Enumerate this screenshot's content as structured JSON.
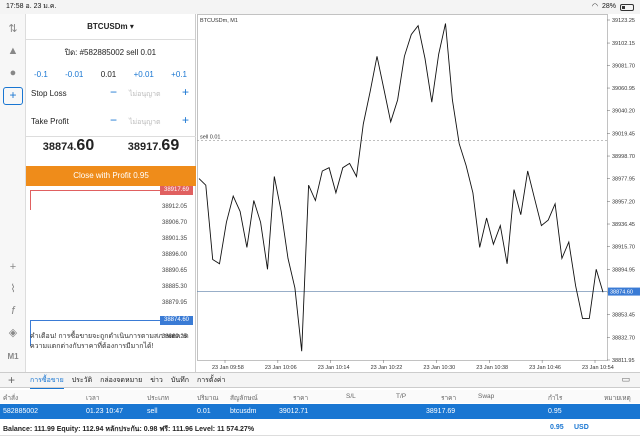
{
  "status": {
    "time": "17:58",
    "date": "อ. 23 ม.ค.",
    "wifi": "wifi",
    "battery": "28%"
  },
  "sidebar": {
    "icons": [
      "quotes-icon",
      "charts-icon",
      "chat-icon",
      "new-order-icon"
    ],
    "tools": [
      "crosshair-icon",
      "indicators-icon",
      "function-icon",
      "objects-icon"
    ],
    "timeframe": "M1"
  },
  "order": {
    "symbol": "BTCUSDm",
    "title": "ปิด: #582885002 sell 0.01",
    "vol_minus": [
      "-0.1",
      "-0.01"
    ],
    "volume": "0.01",
    "vol_plus": [
      "+0.01",
      "+0.1"
    ],
    "stop_loss_label": "Stop Loss",
    "take_profit_label": "Take Profit",
    "not_set": "ไม่อนุญาต",
    "bid_head": "38874.",
    "bid_big": "60",
    "ask_head": "38917.",
    "ask_big": "69",
    "close_label": "Close with Profit 0.95"
  },
  "ladder": {
    "ticks": [
      "38912.05",
      "38906.70",
      "38901.35",
      "38896.00",
      "38890.65",
      "38885.30",
      "38879.95",
      "38869.25"
    ],
    "ask_tag": "38917.69",
    "bid_tag": "38874.60"
  },
  "warning": "คำเตือน! การซื้อขายจะถูกดำเนินการตามสภาพตลาด ความแตกต่างกับราคาที่ต้องการมีมากได้!",
  "chart_data": {
    "type": "line",
    "title": "BTCUSDm, M1",
    "order_line_label": "sell 0.01",
    "order_line_y": 39012.71,
    "last_price": 38874.6,
    "ylim": [
      38811.95,
      39123.25
    ],
    "y_ticks": [
      39123.25,
      39102.15,
      39081.7,
      39060.95,
      39040.2,
      39019.45,
      38998.7,
      38977.95,
      38957.2,
      38936.45,
      38915.7,
      38894.95,
      38874.2,
      38853.45,
      38832.7,
      38811.95
    ],
    "x_ticks": [
      "23 Jan 09:58",
      "23 Jan 10:06",
      "23 Jan 10:14",
      "23 Jan 10:22",
      "23 Jan 10:30",
      "23 Jan 10:38",
      "23 Jan 10:46",
      "23 Jan 10:54"
    ],
    "x_range_minutes": [
      0,
      59
    ],
    "values": [
      38978,
      38972,
      38904,
      38900,
      38938,
      38962,
      38948,
      38915,
      38958,
      38938,
      38895,
      38980,
      38948,
      38905,
      38878,
      38820,
      38972,
      38958,
      38985,
      38988,
      38965,
      38988,
      38992,
      38980,
      39028,
      39058,
      39090,
      39060,
      39030,
      39050,
      39090,
      39110,
      39118,
      39088,
      39048,
      39092,
      39120,
      39050,
      39010,
      38990,
      38965,
      38915,
      38942,
      38918,
      38935,
      38900,
      38968,
      38945,
      38985,
      38960,
      38935,
      38940,
      38955,
      38905,
      38920,
      38880,
      38850,
      38850,
      38895,
      38874
    ]
  },
  "tabs": [
    "การซื้อขาย",
    "ประวัติ",
    "กล่องจดหมาย",
    "ข่าว",
    "บันทึก",
    "การตั้งค่า"
  ],
  "grid": {
    "headers": [
      "คำสั่ง",
      "เวลา",
      "ประเภท",
      "ปริมาณ",
      "สัญลักษณ์",
      "ราคา",
      "S/L",
      "T/P",
      "ราคา",
      "Swap",
      "กำไร",
      "หมายเหตุ"
    ],
    "row": [
      "582885002",
      "01.23 10:47",
      "sell",
      "0.01",
      "btcusdm",
      "39012.71",
      "",
      "",
      "38917.69",
      "",
      "0.95",
      ""
    ]
  },
  "balance": {
    "text": "Balance: 111.99 Equity: 112.94 หลักประกัน: 0.98 ฟรี: 111.96 Level: 11 574.27%",
    "profit": "0.95",
    "currency": "USD"
  },
  "colors": {
    "accent": "#1976d2",
    "close_button": "#ef8c1a",
    "ask": "#e06060",
    "bid": "#3a7bd5"
  }
}
